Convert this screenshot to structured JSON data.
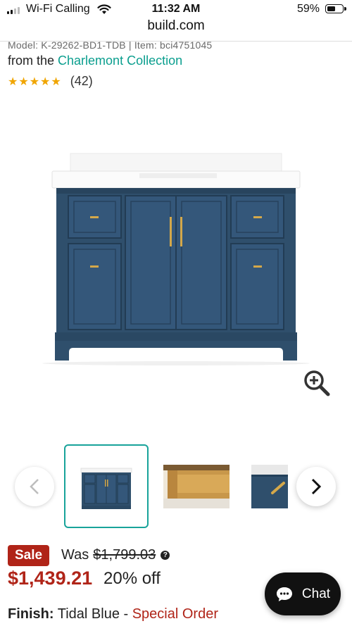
{
  "status_bar": {
    "carrier": "Wi-Fi Calling",
    "time": "11:32 AM",
    "battery": "59%",
    "battery_level": 0.59
  },
  "browser": {
    "url": "build.com"
  },
  "product": {
    "model_line": "Model: K-29262-BD1-TDB | Item: bci4751045",
    "from_text": "from the ",
    "collection": "Charlemont Collection",
    "stars": "★★★★★",
    "rating": 5,
    "review_count": "(42)"
  },
  "gallery": {
    "zoom_icon": "zoom-in-icon",
    "prev_icon": "chevron-left-icon",
    "next_icon": "chevron-right-icon"
  },
  "pricing": {
    "badge": "Sale",
    "was_label": "Was",
    "was_price": "$1,799.03",
    "info_icon": "?",
    "sale_price": "$1,439.21",
    "discount": "20% off"
  },
  "finish": {
    "label": "Finish:",
    "value": " Tidal Blue - ",
    "status": "Special Order"
  },
  "chat": {
    "label": "Chat",
    "icon": "chat-bubble-icon"
  },
  "colors": {
    "accent_teal": "#0a9e8e",
    "sale_red": "#b02418",
    "vanity_blue": "#2f4f6c",
    "star_gold": "#f0a500"
  }
}
